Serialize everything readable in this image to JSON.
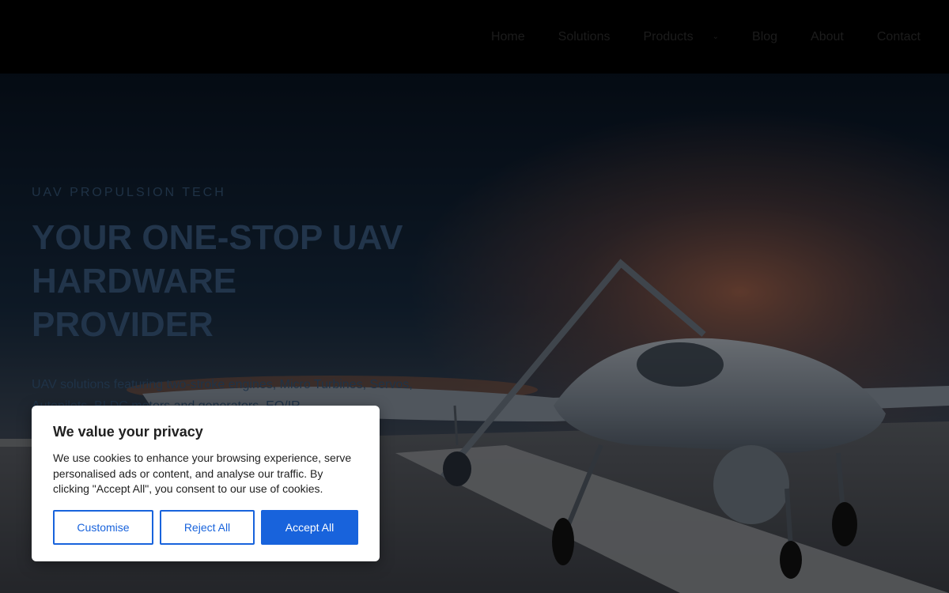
{
  "nav": {
    "items": [
      {
        "label": "Home"
      },
      {
        "label": "Solutions"
      },
      {
        "label": "Products"
      },
      {
        "label": "Blog"
      },
      {
        "label": "About"
      },
      {
        "label": "Contact"
      }
    ]
  },
  "hero": {
    "eyebrow": "UAV PROPULSION TECH",
    "headline": "YOUR ONE-STOP UAV\nHARDWARE\nPROVIDER",
    "subtext": "UAV solutions featuring two-stroke engines, Micro Turbines, Servos, Autopilots, BLDC motors and generators, EO/IR"
  },
  "cookie": {
    "title": "We value your privacy",
    "body": "We use cookies to enhance your browsing experience, serve personalised ads or content, and analyse our traffic. By clicking \"Accept All\", you consent to our use of cookies.",
    "customise_label": "Customise",
    "reject_label": "Reject All",
    "accept_label": "Accept All",
    "accent_color": "#1863dc"
  },
  "icons": {
    "products_dropdown": "chevron-down-icon"
  }
}
